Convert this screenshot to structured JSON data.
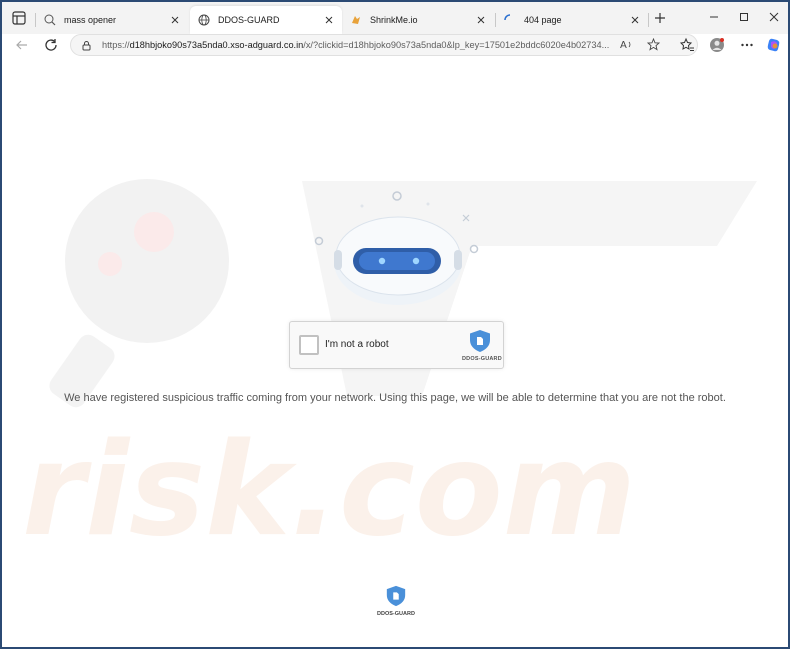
{
  "tabs": [
    {
      "title": "mass opener",
      "icon": "search-globe-icon",
      "active": false
    },
    {
      "title": "DDOS-GUARD",
      "icon": "globe-icon",
      "active": true
    },
    {
      "title": "ShrinkMe.io",
      "icon": "shrinkme-icon",
      "active": false
    },
    {
      "title": "404 page",
      "icon": "loading-spinner-icon",
      "active": false
    }
  ],
  "address_bar": {
    "url_prefix": "https://",
    "host": "d18hbjoko90s73a5nda0.xso-adguard.co.in",
    "url_rest": "/x/?clickid=d18hbjoko90s73a5nda0&lp_key=17501e2bddc6020e4b02734..."
  },
  "captcha": {
    "label": "I'm not a robot",
    "brand": "DDOS-GUARD"
  },
  "message": "We have registered suspicious traffic coming from your network. Using this page, we will be able to determine that you are not the robot.",
  "footer": {
    "brand": "DDOS-GUARD"
  },
  "watermark_text": "risk.com",
  "colors": {
    "accent": "#4a90d9",
    "shield": "#4a90d9",
    "window_frame": "#2b4a74"
  }
}
